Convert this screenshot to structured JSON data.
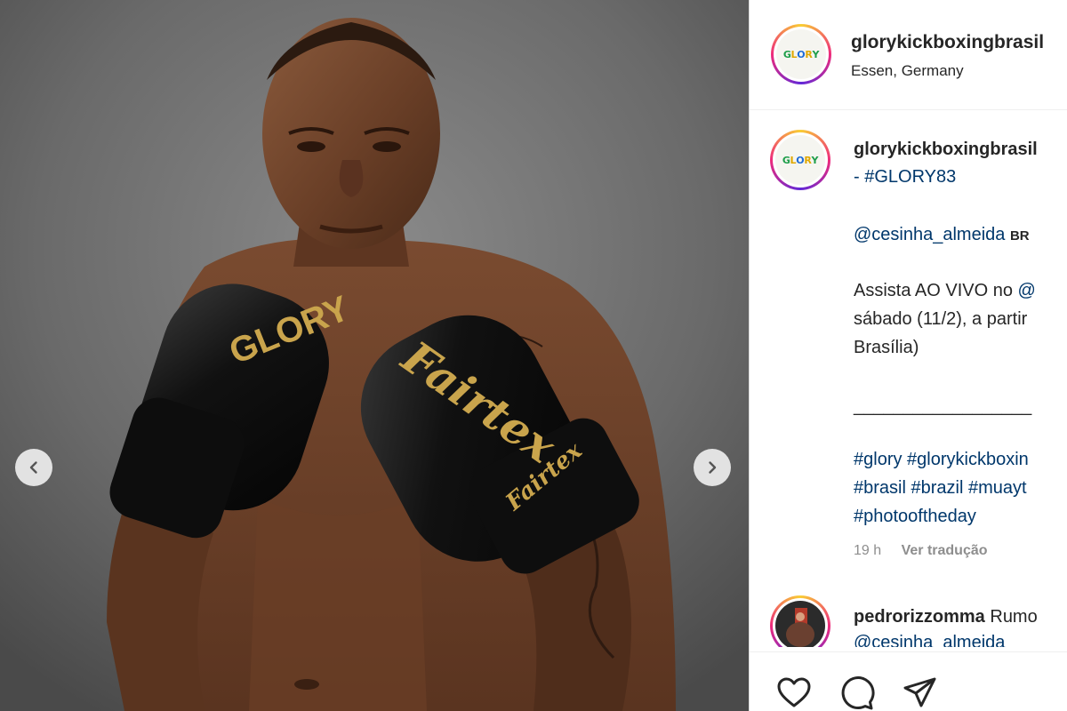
{
  "post": {
    "username": "glorykickboxingbrasil",
    "location": "Essen, Germany",
    "avatar_text": "GLORY",
    "photo_alt": "Fighter in black and gold gloves",
    "glove_left_text": "GLORY",
    "glove_right_text": "Fairtex",
    "glove_right_strap_text": "Fairtex"
  },
  "caption": {
    "username": "glorykickboxingbrasil",
    "line1": "- #GLORY83",
    "mention": "@cesinha_almeida",
    "flag": "BR",
    "line3_prefix": "Assista AO VIVO no ",
    "line3_link": "@",
    "line4": "sábado (11/2), a partir",
    "line5": "Brasília)",
    "separator": "__________________",
    "tags1": "#glory #glorykickboxin",
    "tags2": "#brasil #brazil #muayt",
    "tags3": "#photooftheday",
    "time": "19 h",
    "translate": "Ver tradução"
  },
  "comment": {
    "username": "pedrorizzomma",
    "text": " Rumo",
    "mention": "@cesinha_almeida"
  },
  "colors": {
    "link": "#00376b",
    "text": "#262626",
    "muted": "#8e8e8e",
    "glove_gold": "#c9a44c"
  },
  "icons": {
    "prev": "chevron-left-icon",
    "next": "chevron-right-icon",
    "like": "heart-icon",
    "comment": "comment-icon",
    "share": "paper-plane-icon"
  }
}
